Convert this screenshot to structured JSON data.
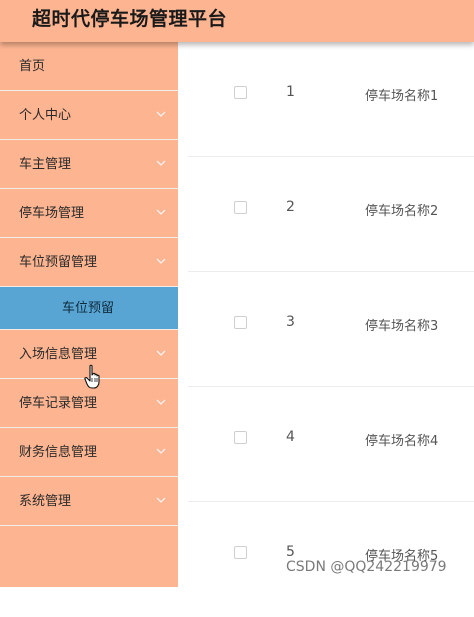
{
  "app": {
    "title": "超时代停车场管理平台"
  },
  "sidebar": {
    "items": [
      {
        "label": "首页",
        "has_chevron": false
      },
      {
        "label": "个人中心",
        "has_chevron": true
      },
      {
        "label": "车主管理",
        "has_chevron": true
      },
      {
        "label": "停车场管理",
        "has_chevron": true
      },
      {
        "label": "车位预留管理",
        "has_chevron": true,
        "expanded": true
      },
      {
        "label": "车位预留",
        "submenu": true,
        "active": true
      },
      {
        "label": "入场信息管理",
        "has_chevron": true,
        "hovered": true
      },
      {
        "label": "停车记录管理",
        "has_chevron": true
      },
      {
        "label": "财务信息管理",
        "has_chevron": true
      },
      {
        "label": "系统管理",
        "has_chevron": true
      }
    ],
    "chevron_icon": "chevron-down-icon"
  },
  "table": {
    "rows": [
      {
        "index": "1",
        "name": "停车场名称1"
      },
      {
        "index": "2",
        "name": "停车场名称2"
      },
      {
        "index": "3",
        "name": "停车场名称3"
      },
      {
        "index": "4",
        "name": "停车场名称4"
      },
      {
        "index": "5",
        "name": "停车场名称5"
      }
    ]
  },
  "watermark": {
    "text": "CSDN @QQ242219979"
  },
  "colors": {
    "header_bg": "#fcb491",
    "sidebar_bg": "#fcb491",
    "active_submenu_bg": "#58a5d4",
    "content_bg": "#ffffff"
  }
}
